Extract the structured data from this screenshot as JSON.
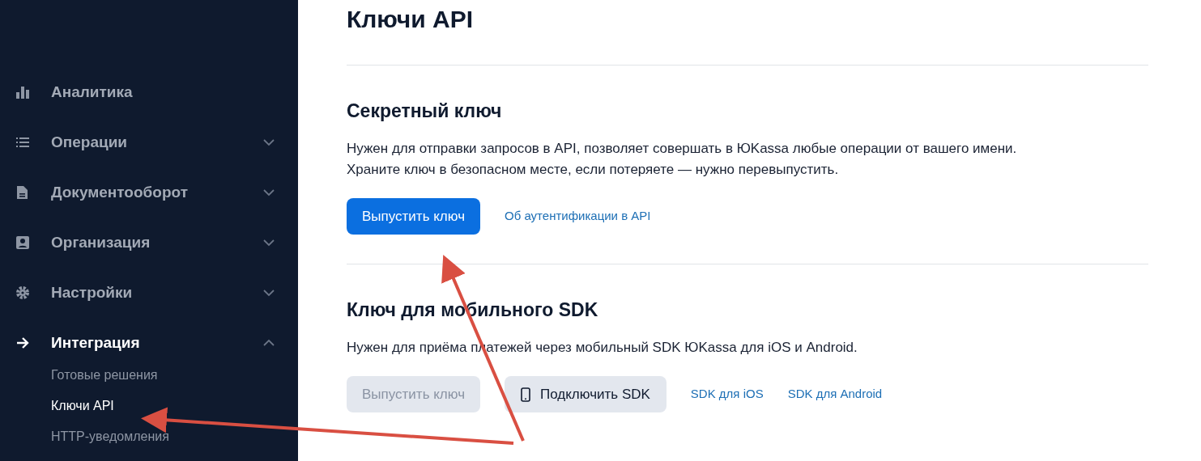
{
  "sidebar": {
    "items": [
      {
        "label": "Аналитика",
        "selected": false
      },
      {
        "label": "Операции",
        "expanded": false,
        "selected": false
      },
      {
        "label": "Документооборот",
        "expanded": false,
        "selected": false
      },
      {
        "label": "Организация",
        "expanded": false,
        "selected": false
      },
      {
        "label": "Настройки",
        "expanded": false,
        "selected": false
      },
      {
        "label": "Интеграция",
        "expanded": true,
        "selected": true,
        "children": [
          {
            "label": "Готовые решения",
            "selected": false
          },
          {
            "label": "Ключи API",
            "selected": true
          },
          {
            "label": "HTTP-уведомления",
            "selected": false
          }
        ]
      }
    ]
  },
  "page": {
    "title": "Ключи API",
    "sections": [
      {
        "title": "Секретный ключ",
        "description": [
          "Нужен для отправки запросов в API, позволяет совершать в ЮKassa любые операции от вашего имени.",
          "Храните ключ в безопасном месте, если потеряете — нужно перевыпустить."
        ],
        "actions": [
          {
            "kind": "primary",
            "label": "Выпустить ключ",
            "disabled": false
          },
          {
            "kind": "link",
            "label": "Об аутентификации в API"
          }
        ]
      },
      {
        "title": "Ключ для мобильного SDK",
        "description": [
          "Нужен для приёма платежей через мобильный SDK ЮKassa для iOS и Android."
        ],
        "actions": [
          {
            "kind": "primary",
            "label": "Выпустить ключ",
            "disabled": true
          },
          {
            "kind": "secondary",
            "label": "Подключить SDK"
          },
          {
            "kind": "link",
            "label": "SDK для iOS"
          },
          {
            "kind": "link",
            "label": "SDK для Android"
          }
        ]
      }
    ]
  }
}
